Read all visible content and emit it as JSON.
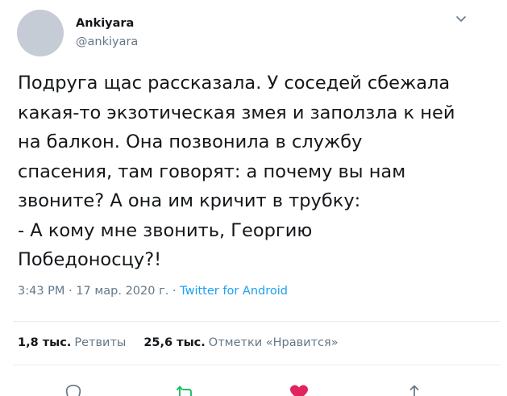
{
  "author": {
    "name": "Ankiyara",
    "handle": "@ankiyara"
  },
  "tweet": {
    "text": "Подруга щас рассказала. У соседей сбежала\nкакая-то экзотическая змея и заползла к ней\nна балкон. Она позвонила в службу\nспасения, там говорят: а почему вы нам\nзвоните? А она им кричит в трубку:\n- А кому мне звонить, Георгию\nПобедоносцу?!"
  },
  "meta": {
    "time": "3:43 PM",
    "separator_1": " · ",
    "date": "17 мар. 2020 г.",
    "separator_2": " · ",
    "source": "Twitter for Android"
  },
  "stats": {
    "retweets_count": "1,8 тыс.",
    "retweets_label": "Ретвиты",
    "likes_count": "25,6 тыс.",
    "likes_label": "Отметки «Нравится»"
  },
  "icons": {
    "caret": "chevron-down-icon",
    "reply": "reply-icon",
    "retweet": "retweet-icon",
    "like": "heart-icon",
    "share": "share-icon"
  },
  "colors": {
    "text": "#14171a",
    "secondary": "#657786",
    "link": "#1da1f2",
    "retweet": "#17bf63",
    "like": "#e0245e",
    "avatar": "#c5ccd6",
    "divider": "#e6ecf0"
  }
}
